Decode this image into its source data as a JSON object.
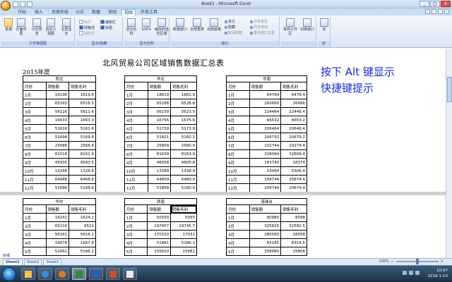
{
  "window": {
    "title": "Book1 - Microsoft Excel",
    "controls": [
      "_",
      "□",
      "X"
    ]
  },
  "tabs": [
    "开始",
    "插入",
    "页面布局",
    "公式",
    "数据",
    "审阅",
    "视图",
    "开发工具"
  ],
  "active_tab": "视图",
  "ribbon": {
    "groups": [
      {
        "label": "工作簿视图",
        "buttons": [
          "普通",
          "页面布局",
          "分页预览",
          "自定义视图",
          "全屏显示"
        ]
      },
      {
        "label": "显示/隐藏",
        "checks": [
          "标尺",
          "网格线",
          "消息栏",
          "编辑栏",
          "标题"
        ]
      },
      {
        "label": "显示比例",
        "buttons": [
          "显示比例",
          "100%",
          "缩放到选定区域"
        ]
      },
      {
        "label": "窗口",
        "buttons": [
          "新建窗口",
          "全部重排",
          "冻结窗格"
        ],
        "small": [
          "拆分",
          "隐藏",
          "取消隐藏",
          "并排查看",
          "同步滚动",
          "重设窗口位置"
        ]
      },
      {
        "label": "",
        "buttons": [
          "保存工作区",
          "切换窗口"
        ]
      },
      {
        "label": "宏",
        "buttons": [
          "宏"
        ]
      }
    ]
  },
  "sheet": {
    "title": "北风贸易公司区域销售数据汇总表",
    "year": "2015年度",
    "top_regions": [
      {
        "name": "西北",
        "headers": [
          "月份",
          "销售额",
          "销售毛利"
        ],
        "rows": [
          [
            "1月",
            "16196",
            "1619.6"
          ],
          [
            "2月",
            "65165",
            "6516.5"
          ],
          [
            "3月",
            "56116",
            "5611.6"
          ],
          [
            "4月",
            "16633",
            "1663.3"
          ],
          [
            "5月",
            "51616",
            "5161.6"
          ],
          [
            "6月",
            "51698",
            "5169.8"
          ],
          [
            "7月",
            "25686",
            "2568.6"
          ],
          [
            "8月",
            "81516",
            "8151.6"
          ],
          [
            "9月",
            "45935",
            "4593.5"
          ],
          [
            "10月",
            "13266",
            "1326.6"
          ],
          [
            "11月",
            "64686",
            "6468.6"
          ],
          [
            "12月",
            "51686",
            "5168.6"
          ]
        ]
      },
      {
        "name": "华北",
        "headers": [
          "月份",
          "销售额",
          "销售毛利"
        ],
        "rows": [
          [
            "1月",
            "18819",
            "1881.9"
          ],
          [
            "2月",
            "65288",
            "6528.8"
          ],
          [
            "3月",
            "56239",
            "5623.9"
          ],
          [
            "4月",
            "16756",
            "1675.6"
          ],
          [
            "5月",
            "51739",
            "5173.9"
          ],
          [
            "6月",
            "51821",
            "5182.1"
          ],
          [
            "7月",
            "25809",
            "2580.9"
          ],
          [
            "8月",
            "81639",
            "8163.9"
          ],
          [
            "9月",
            "46058",
            "4605.8"
          ],
          [
            "10月",
            "13389",
            "1338.9"
          ],
          [
            "11月",
            "64809",
            "6480.9"
          ],
          [
            "12月",
            "51809",
            "5180.9"
          ]
        ]
      },
      {
        "name": "华南",
        "headers": [
          "月份",
          "销售额",
          "销售毛利"
        ],
        "rows": [
          [
            "1月",
            "64784",
            "6478.4"
          ],
          [
            "2月",
            "260660",
            "26066"
          ],
          [
            "3月",
            "224464",
            "22446.4"
          ],
          [
            "4月",
            "66532",
            "6653.2"
          ],
          [
            "5月",
            "206464",
            "20646.4"
          ],
          [
            "6月",
            "206792",
            "20679.2"
          ],
          [
            "7月",
            "102744",
            "10274.4"
          ],
          [
            "8月",
            "326064",
            "32606.4"
          ],
          [
            "9月",
            "183740",
            "18374"
          ],
          [
            "10月",
            "53064",
            "5306.4"
          ],
          [
            "11月",
            "258744",
            "25874.4"
          ],
          [
            "12月",
            "206744",
            "20674.4"
          ]
        ]
      }
    ],
    "bottom_regions": [
      {
        "name": "华中",
        "headers": [
          "月份",
          "销售额",
          "销售毛利"
        ],
        "rows": [
          [
            "1月",
            "16241",
            "1624.1"
          ],
          [
            "2月",
            "65210",
            "6521"
          ],
          [
            "3月",
            "56161",
            "5616.1"
          ],
          [
            "4月",
            "16678",
            "1667.8"
          ],
          [
            "5月",
            "51661",
            "5166.1"
          ]
        ]
      },
      {
        "name": "西南",
        "headers": [
          "月份",
          "销售额",
          "销售毛利"
        ],
        "rows": [
          [
            "1月",
            "50550",
            "5055"
          ],
          [
            "2月",
            "197457",
            "19745.7"
          ],
          [
            "3月",
            "170310",
            "17031"
          ],
          [
            "4月",
            "51861",
            "5186.1"
          ],
          [
            "5月",
            "156810",
            "15681"
          ]
        ]
      },
      {
        "name": "港澳台",
        "headers": [
          "月份",
          "销售额",
          "销售毛利"
        ],
        "rows": [
          [
            "1月",
            "80980",
            "8098"
          ],
          [
            "2月",
            "325825",
            "32582.5"
          ],
          [
            "3月",
            "280580",
            "28058"
          ],
          [
            "4月",
            "83165",
            "8316.5"
          ],
          [
            "5月",
            "258080",
            "25808"
          ]
        ]
      }
    ]
  },
  "hint_text": [
    "按下 Alt 键显示",
    "快捷键提示"
  ],
  "status": {
    "ready": "就绪",
    "sheet_tabs": [
      "Sheet1",
      "Sheet2",
      "Sheet3"
    ],
    "zoom": "100%"
  },
  "taskbar": {
    "time": "10:07",
    "date": "2016-1-13"
  }
}
